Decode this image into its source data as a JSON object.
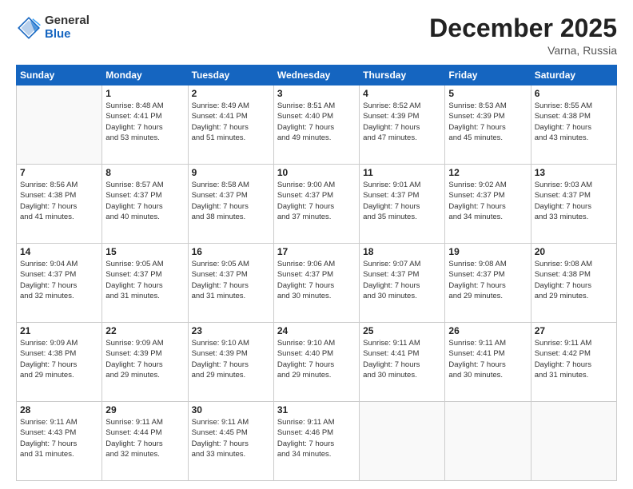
{
  "logo": {
    "general": "General",
    "blue": "Blue"
  },
  "title": "December 2025",
  "location": "Varna, Russia",
  "weekdays": [
    "Sunday",
    "Monday",
    "Tuesday",
    "Wednesday",
    "Thursday",
    "Friday",
    "Saturday"
  ],
  "weeks": [
    [
      {
        "day": "",
        "info": ""
      },
      {
        "day": "1",
        "info": "Sunrise: 8:48 AM\nSunset: 4:41 PM\nDaylight: 7 hours\nand 53 minutes."
      },
      {
        "day": "2",
        "info": "Sunrise: 8:49 AM\nSunset: 4:41 PM\nDaylight: 7 hours\nand 51 minutes."
      },
      {
        "day": "3",
        "info": "Sunrise: 8:51 AM\nSunset: 4:40 PM\nDaylight: 7 hours\nand 49 minutes."
      },
      {
        "day": "4",
        "info": "Sunrise: 8:52 AM\nSunset: 4:39 PM\nDaylight: 7 hours\nand 47 minutes."
      },
      {
        "day": "5",
        "info": "Sunrise: 8:53 AM\nSunset: 4:39 PM\nDaylight: 7 hours\nand 45 minutes."
      },
      {
        "day": "6",
        "info": "Sunrise: 8:55 AM\nSunset: 4:38 PM\nDaylight: 7 hours\nand 43 minutes."
      }
    ],
    [
      {
        "day": "7",
        "info": "Sunrise: 8:56 AM\nSunset: 4:38 PM\nDaylight: 7 hours\nand 41 minutes."
      },
      {
        "day": "8",
        "info": "Sunrise: 8:57 AM\nSunset: 4:37 PM\nDaylight: 7 hours\nand 40 minutes."
      },
      {
        "day": "9",
        "info": "Sunrise: 8:58 AM\nSunset: 4:37 PM\nDaylight: 7 hours\nand 38 minutes."
      },
      {
        "day": "10",
        "info": "Sunrise: 9:00 AM\nSunset: 4:37 PM\nDaylight: 7 hours\nand 37 minutes."
      },
      {
        "day": "11",
        "info": "Sunrise: 9:01 AM\nSunset: 4:37 PM\nDaylight: 7 hours\nand 35 minutes."
      },
      {
        "day": "12",
        "info": "Sunrise: 9:02 AM\nSunset: 4:37 PM\nDaylight: 7 hours\nand 34 minutes."
      },
      {
        "day": "13",
        "info": "Sunrise: 9:03 AM\nSunset: 4:37 PM\nDaylight: 7 hours\nand 33 minutes."
      }
    ],
    [
      {
        "day": "14",
        "info": "Sunrise: 9:04 AM\nSunset: 4:37 PM\nDaylight: 7 hours\nand 32 minutes."
      },
      {
        "day": "15",
        "info": "Sunrise: 9:05 AM\nSunset: 4:37 PM\nDaylight: 7 hours\nand 31 minutes."
      },
      {
        "day": "16",
        "info": "Sunrise: 9:05 AM\nSunset: 4:37 PM\nDaylight: 7 hours\nand 31 minutes."
      },
      {
        "day": "17",
        "info": "Sunrise: 9:06 AM\nSunset: 4:37 PM\nDaylight: 7 hours\nand 30 minutes."
      },
      {
        "day": "18",
        "info": "Sunrise: 9:07 AM\nSunset: 4:37 PM\nDaylight: 7 hours\nand 30 minutes."
      },
      {
        "day": "19",
        "info": "Sunrise: 9:08 AM\nSunset: 4:37 PM\nDaylight: 7 hours\nand 29 minutes."
      },
      {
        "day": "20",
        "info": "Sunrise: 9:08 AM\nSunset: 4:38 PM\nDaylight: 7 hours\nand 29 minutes."
      }
    ],
    [
      {
        "day": "21",
        "info": "Sunrise: 9:09 AM\nSunset: 4:38 PM\nDaylight: 7 hours\nand 29 minutes."
      },
      {
        "day": "22",
        "info": "Sunrise: 9:09 AM\nSunset: 4:39 PM\nDaylight: 7 hours\nand 29 minutes."
      },
      {
        "day": "23",
        "info": "Sunrise: 9:10 AM\nSunset: 4:39 PM\nDaylight: 7 hours\nand 29 minutes."
      },
      {
        "day": "24",
        "info": "Sunrise: 9:10 AM\nSunset: 4:40 PM\nDaylight: 7 hours\nand 29 minutes."
      },
      {
        "day": "25",
        "info": "Sunrise: 9:11 AM\nSunset: 4:41 PM\nDaylight: 7 hours\nand 30 minutes."
      },
      {
        "day": "26",
        "info": "Sunrise: 9:11 AM\nSunset: 4:41 PM\nDaylight: 7 hours\nand 30 minutes."
      },
      {
        "day": "27",
        "info": "Sunrise: 9:11 AM\nSunset: 4:42 PM\nDaylight: 7 hours\nand 31 minutes."
      }
    ],
    [
      {
        "day": "28",
        "info": "Sunrise: 9:11 AM\nSunset: 4:43 PM\nDaylight: 7 hours\nand 31 minutes."
      },
      {
        "day": "29",
        "info": "Sunrise: 9:11 AM\nSunset: 4:44 PM\nDaylight: 7 hours\nand 32 minutes."
      },
      {
        "day": "30",
        "info": "Sunrise: 9:11 AM\nSunset: 4:45 PM\nDaylight: 7 hours\nand 33 minutes."
      },
      {
        "day": "31",
        "info": "Sunrise: 9:11 AM\nSunset: 4:46 PM\nDaylight: 7 hours\nand 34 minutes."
      },
      {
        "day": "",
        "info": ""
      },
      {
        "day": "",
        "info": ""
      },
      {
        "day": "",
        "info": ""
      }
    ]
  ]
}
